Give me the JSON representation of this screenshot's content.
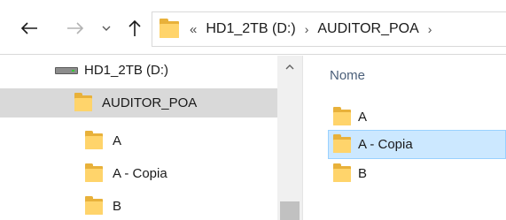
{
  "toolbar": {
    "back_icon": "arrow-left-icon",
    "forward_icon": "arrow-right-icon",
    "recent_icon": "chevron-down-icon",
    "up_icon": "arrow-up-icon"
  },
  "address": {
    "more_symbol": "«",
    "crumbs": [
      "HD1_2TB (D:)",
      "AUDITOR_POA"
    ],
    "separator": "›"
  },
  "navigation_pane": {
    "items": [
      {
        "label": "HD1_2TB (D:)",
        "icon": "drive-icon",
        "selected": false
      },
      {
        "label": "AUDITOR_POA",
        "icon": "folder-icon",
        "selected": true
      },
      {
        "label": "A",
        "icon": "folder-icon",
        "selected": false
      },
      {
        "label": "A - Copia",
        "icon": "folder-icon",
        "selected": false
      },
      {
        "label": "B",
        "icon": "folder-icon",
        "selected": false
      }
    ]
  },
  "content_pane": {
    "column_header": "Nome",
    "items": [
      {
        "label": "A",
        "icon": "folder-icon",
        "selected": false
      },
      {
        "label": "A - Copia",
        "icon": "folder-icon",
        "selected": true
      },
      {
        "label": "B",
        "icon": "folder-icon",
        "selected": false
      }
    ]
  },
  "colors": {
    "folder_yellow": "#ffd46b",
    "selected_nav_bg": "#d9d9d9",
    "selected_row_bg": "#cce8ff",
    "header_text": "#4c607a"
  }
}
